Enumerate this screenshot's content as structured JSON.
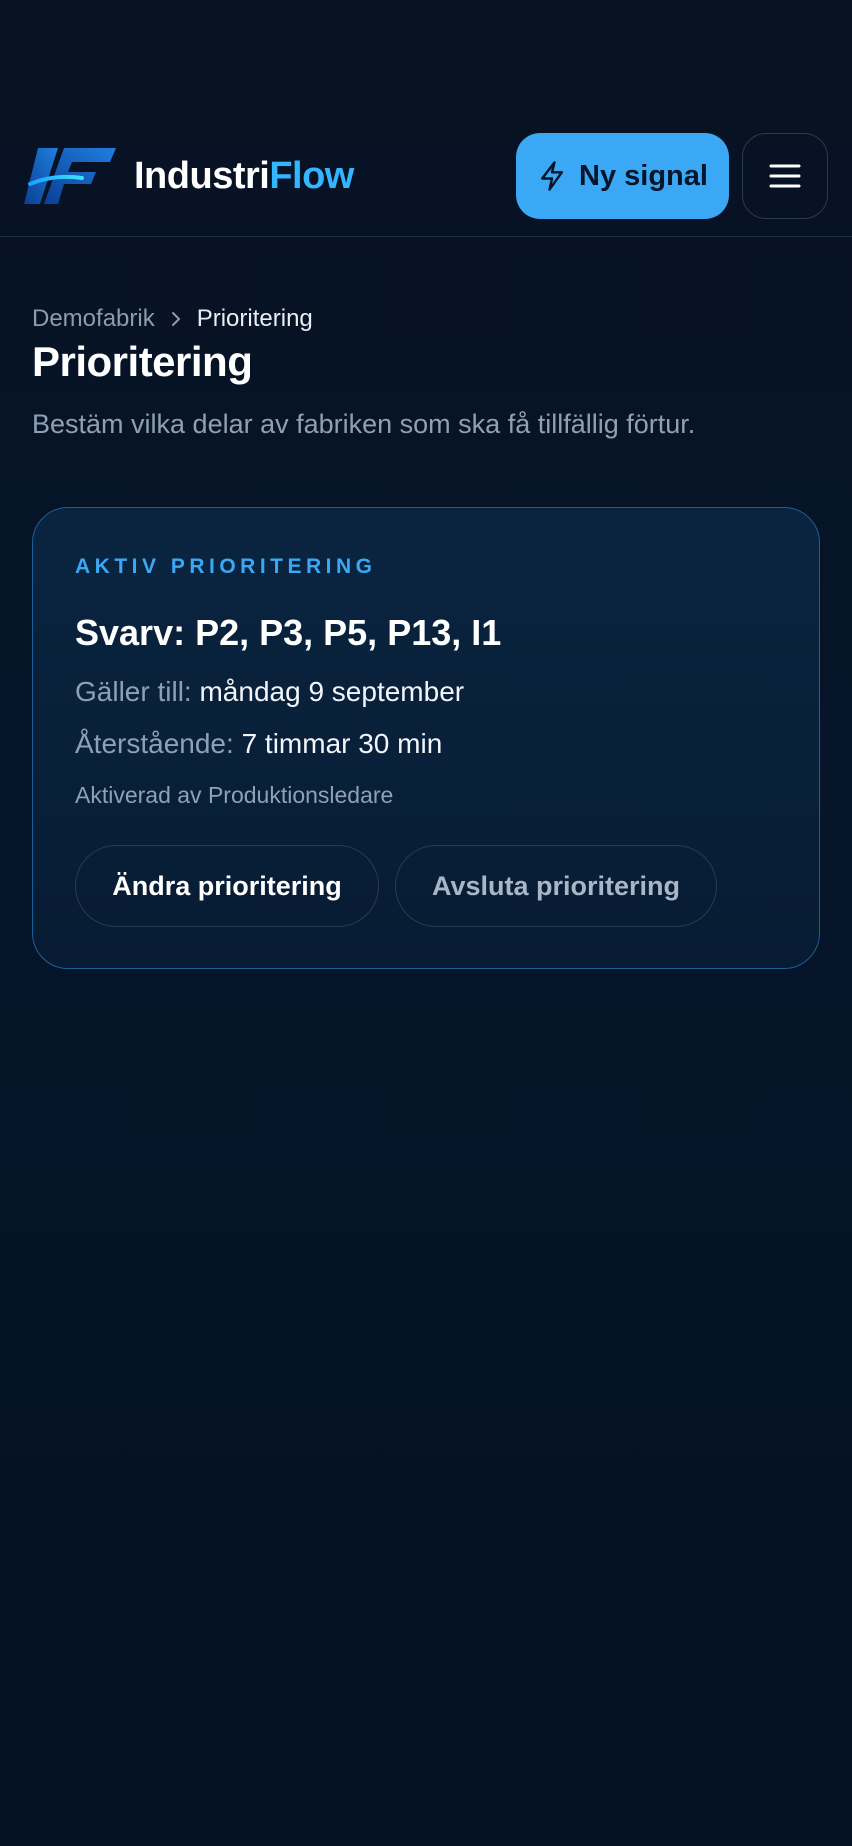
{
  "header": {
    "brand_part1": "Industri",
    "brand_part2": "Flow",
    "new_signal_label": "Ny signal",
    "accent_color": "#3aa8f5",
    "icons": {
      "logo": "industriflow-logo",
      "signal": "lightning-icon",
      "menu": "hamburger-menu-icon"
    }
  },
  "breadcrumb": {
    "home": "Demofabrik",
    "current": "Prioritering"
  },
  "page": {
    "title": "Prioritering",
    "subtitle": "Bestäm vilka delar av fabriken som ska få tillfällig förtur."
  },
  "card": {
    "label": "AKTIV PRIORITERING",
    "title": "Svarv: P2, P3, P5, P13, I1",
    "valid_until_label": "Gäller till:",
    "valid_until_value": "måndag 9 september",
    "remaining_label": "Återstående:",
    "remaining_value": "7 timmar 30 min",
    "activated_by": "Aktiverad av Produktionsledare",
    "change_button": "Ändra prioritering",
    "end_button": "Avsluta prioritering"
  }
}
